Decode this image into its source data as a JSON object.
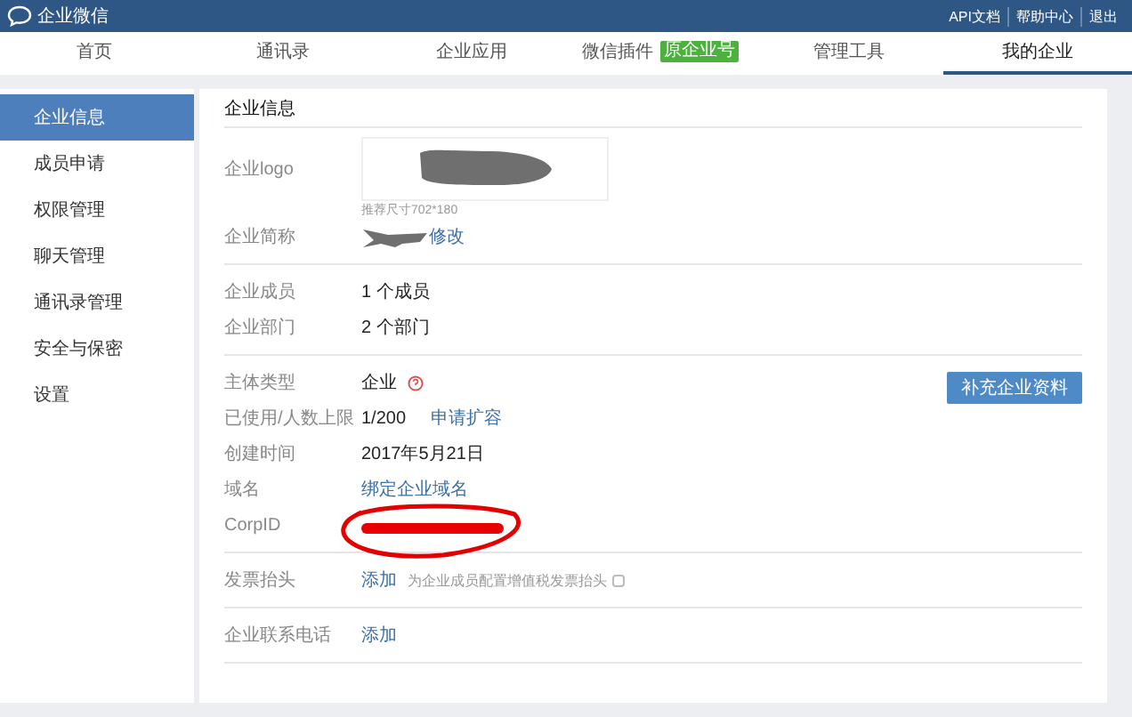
{
  "header": {
    "title": "企业微信",
    "links": [
      "API文档",
      "帮助中心",
      "退出"
    ]
  },
  "nav": [
    {
      "label": "首页",
      "selected": false
    },
    {
      "label": "通讯录",
      "selected": false
    },
    {
      "label": "企业应用",
      "selected": false
    },
    {
      "label": "微信插件",
      "selected": false,
      "badge": "原企业号"
    },
    {
      "label": "管理工具",
      "selected": false
    },
    {
      "label": "我的企业",
      "selected": true
    }
  ],
  "sidebar": {
    "items": [
      {
        "label": "企业信息",
        "selected": true
      },
      {
        "label": "成员申请",
        "selected": false
      },
      {
        "label": "权限管理",
        "selected": false
      },
      {
        "label": "聊天管理",
        "selected": false
      },
      {
        "label": "通讯录管理",
        "selected": false
      },
      {
        "label": "安全与保密",
        "selected": false
      },
      {
        "label": "设置",
        "selected": false
      }
    ]
  },
  "panel": {
    "title": "企业信息",
    "sections": [
      {
        "rows": [
          {
            "kind": "logo",
            "label": "企业logo",
            "hint": "推荐尺寸702*180"
          },
          {
            "kind": "name",
            "label": "企业简称",
            "link": "修改"
          }
        ]
      },
      {
        "rows": [
          {
            "kind": "text",
            "label": "企业成员",
            "value": "1 个成员"
          },
          {
            "kind": "text",
            "label": "企业部门",
            "value": "2 个部门"
          }
        ]
      },
      {
        "action": "补充企业资料",
        "rows": [
          {
            "kind": "type",
            "label": "主体类型",
            "value": "企业"
          },
          {
            "kind": "usage",
            "label": "已使用/人数上限",
            "value": "1/200",
            "link": "申请扩容"
          },
          {
            "kind": "text",
            "label": "创建时间",
            "value": "2017年5月21日"
          },
          {
            "kind": "link",
            "label": "域名",
            "link": "绑定企业域名"
          },
          {
            "kind": "corpid",
            "label": "CorpID"
          }
        ]
      },
      {
        "rows": [
          {
            "kind": "invoice",
            "label": "发票抬头",
            "link": "添加",
            "note": "为企业成员配置增值税发票抬头"
          }
        ]
      },
      {
        "rows": [
          {
            "kind": "link",
            "label": "企业联系电话",
            "link": "添加"
          }
        ]
      }
    ]
  }
}
